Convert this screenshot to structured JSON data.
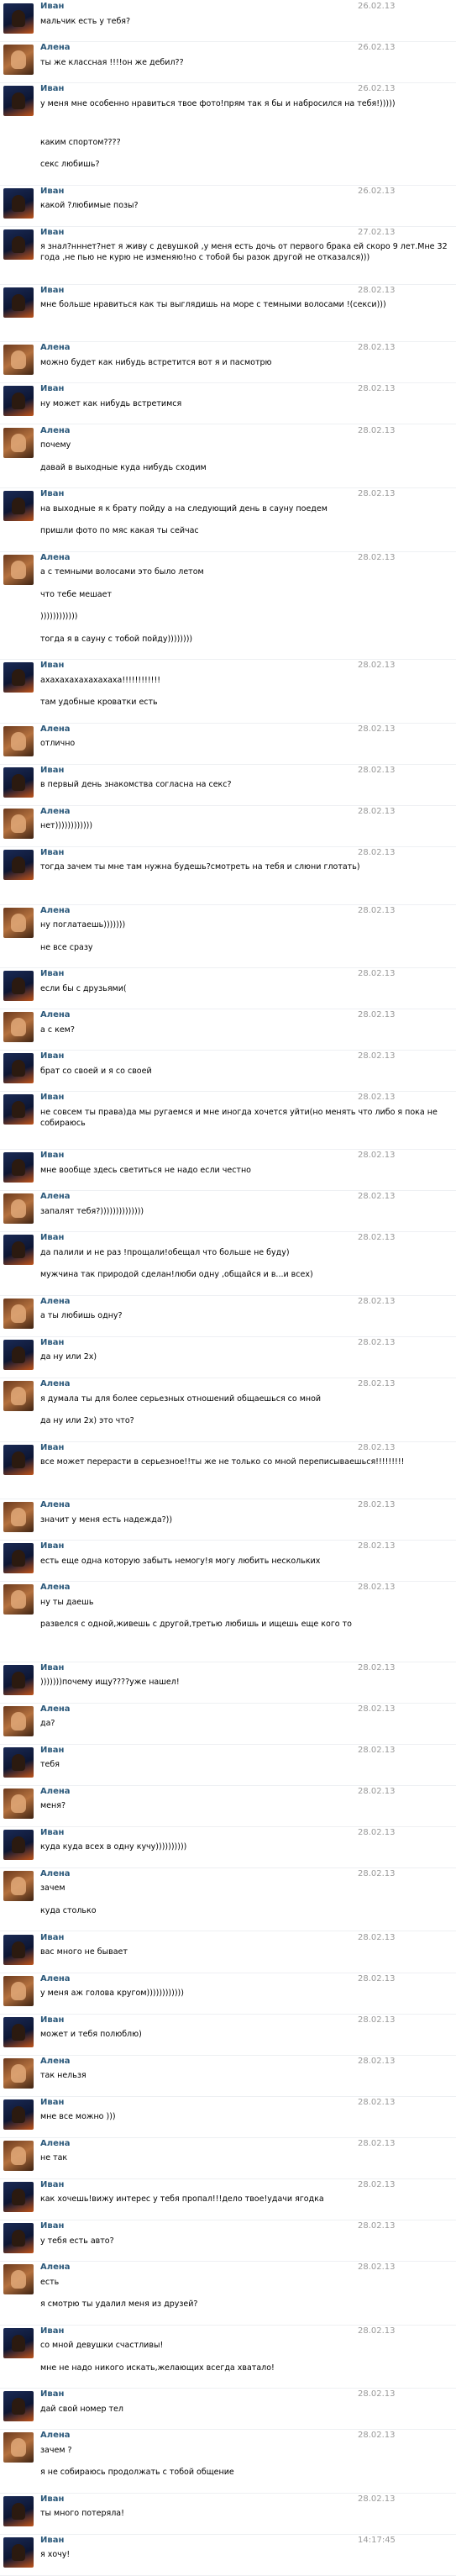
{
  "messages": [
    {
      "author": "Иван",
      "time": "26.02.13",
      "lines": [
        "мальчик есть у тебя?"
      ]
    },
    {
      "author": "Алена",
      "time": "26.02.13",
      "lines": [
        "ты же классная !!!!он же дебил??"
      ]
    },
    {
      "author": "Иван",
      "time": "26.02.13",
      "lines": [
        "у меня мне особенно нравиться твое фото!прям так я бы и набросился на тебя!)))))",
        "каким спортом????",
        "секс любишь?"
      ]
    },
    {
      "author": "Иван",
      "time": "26.02.13",
      "lines": [
        "какой ?любимые позы?"
      ]
    },
    {
      "author": "Иван",
      "time": "27.02.13",
      "lines": [
        "я знал?нннет?нет я живу с девушкой ,у меня есть дочь от первого брака ей скоро 9 лет.Мне 32 года ,не пью не курю не изменяю!но с тобой бы разок другой не отказался)))"
      ]
    },
    {
      "author": "Иван",
      "time": "28.02.13",
      "lines": [
        "мне больше нравиться как ты выглядишь на море с темными волосами !(секси)))"
      ]
    },
    {
      "author": "Алена",
      "time": "28.02.13",
      "lines": [
        "можно будет как нибудь встретится вот я и пасмотрю"
      ]
    },
    {
      "author": "Иван",
      "time": "28.02.13",
      "lines": [
        "ну может как нибудь встретимся"
      ]
    },
    {
      "author": "Алена",
      "time": "28.02.13",
      "lines": [
        "почему",
        "давай в выходные куда нибудь сходим"
      ]
    },
    {
      "author": "Иван",
      "time": "28.02.13",
      "lines": [
        "на выходные я к брату пойду а на следующий день в сауну поедем",
        "пришли фото по мяс какая ты сейчас"
      ]
    },
    {
      "author": "Алена",
      "time": "28.02.13",
      "lines": [
        "а с темными волосами это было летом",
        "что тебе мешает",
        "))))))))))))",
        "тогда я в сауну с тобой пойду))))))))"
      ]
    },
    {
      "author": "Иван",
      "time": "28.02.13",
      "lines": [
        "ахахахахахахахаха!!!!!!!!!!!!",
        "там удобные кроватки есть"
      ]
    },
    {
      "author": "Алена",
      "time": "28.02.13",
      "lines": [
        "отлично"
      ]
    },
    {
      "author": "Иван",
      "time": "28.02.13",
      "lines": [
        "в первый день знакомства согласна на секс?"
      ]
    },
    {
      "author": "Алена",
      "time": "28.02.13",
      "lines": [
        "нет))))))))))))"
      ]
    },
    {
      "author": "Иван",
      "time": "28.02.13",
      "lines": [
        "тогда зачем ты мне там нужна будешь?смотреть на тебя и слюни глотать)"
      ]
    },
    {
      "author": "Алена",
      "time": "28.02.13",
      "lines": [
        "ну поглатаешь)))))))",
        "не все сразу"
      ]
    },
    {
      "author": "Иван",
      "time": "28.02.13",
      "lines": [
        "если бы с друзьями("
      ]
    },
    {
      "author": "Алена",
      "time": "28.02.13",
      "lines": [
        "а с кем?"
      ]
    },
    {
      "author": "Иван",
      "time": "28.02.13",
      "lines": [
        "брат со своей и я со своей"
      ]
    },
    {
      "author": "Иван",
      "time": "28.02.13",
      "lines": [
        "не совсем ты права)да мы ругаемся и мне иногда хочется уйти(но менять что либо я пока не собираюсь"
      ]
    },
    {
      "author": "Иван",
      "time": "28.02.13",
      "lines": [
        "мне вообще здесь светиться не надо если честно"
      ]
    },
    {
      "author": "Алена",
      "time": "28.02.13",
      "lines": [
        "запалят тебя?))))))))))))))"
      ]
    },
    {
      "author": "Иван",
      "time": "28.02.13",
      "lines": [
        "да палили и не раз !прощали!обещал что больше не буду)",
        "мужчина так природой сделан!люби одну ,общайся и в...и всех)"
      ]
    },
    {
      "author": "Алена",
      "time": "28.02.13",
      "lines": [
        "а ты любишь одну?"
      ]
    },
    {
      "author": "Иван",
      "time": "28.02.13",
      "lines": [
        "да ну или 2х)"
      ]
    },
    {
      "author": "Алена",
      "time": "28.02.13",
      "lines": [
        "я думала ты для более серьезных отношений общаешься со мной",
        "да ну или 2х) это что?"
      ]
    },
    {
      "author": "Иван",
      "time": "28.02.13",
      "lines": [
        "все может перерасти в серьезное!!ты же не только со мной переписываешься!!!!!!!!!"
      ]
    },
    {
      "author": "Алена",
      "time": "28.02.13",
      "lines": [
        "значит у меня есть надежда?))"
      ]
    },
    {
      "author": "Иван",
      "time": "28.02.13",
      "lines": [
        "есть еще одна которую забыть немогу!я могу любить нескольких"
      ]
    },
    {
      "author": "Алена",
      "time": "28.02.13",
      "lines": [
        "ну ты даешь",
        "развелся с одной,живешь с другой,третью любишь и ищешь еще кого то"
      ]
    },
    {
      "author": "Иван",
      "time": "28.02.13",
      "lines": [
        ")))))))почему ищу????уже нашел!"
      ]
    },
    {
      "author": "Алена",
      "time": "28.02.13",
      "lines": [
        "да?"
      ]
    },
    {
      "author": "Иван",
      "time": "28.02.13",
      "lines": [
        "тебя"
      ]
    },
    {
      "author": "Алена",
      "time": "28.02.13",
      "lines": [
        "меня?"
      ]
    },
    {
      "author": "Иван",
      "time": "28.02.13",
      "lines": [
        "куда куда всех в одну кучу))))))))))"
      ]
    },
    {
      "author": "Алена",
      "time": "28.02.13",
      "lines": [
        "зачем",
        "куда столько"
      ]
    },
    {
      "author": "Иван",
      "time": "28.02.13",
      "lines": [
        "вас много не бывает"
      ]
    },
    {
      "author": "Алена",
      "time": "28.02.13",
      "lines": [
        "у меня аж голова кругом))))))))))))"
      ]
    },
    {
      "author": "Иван",
      "time": "28.02.13",
      "lines": [
        "может и тебя полюблю)"
      ]
    },
    {
      "author": "Алена",
      "time": "28.02.13",
      "lines": [
        "так нельзя"
      ]
    },
    {
      "author": "Иван",
      "time": "28.02.13",
      "lines": [
        "мне все можно )))"
      ]
    },
    {
      "author": "Алена",
      "time": "28.02.13",
      "lines": [
        "не так"
      ]
    },
    {
      "author": "Иван",
      "time": "28.02.13",
      "lines": [
        "как хочешь!вижу интерес у тебя пропал!!!дело твое!удачи ягодка"
      ]
    },
    {
      "author": "Иван",
      "time": "28.02.13",
      "lines": [
        "у тебя есть авто?"
      ]
    },
    {
      "author": "Алена",
      "time": "28.02.13",
      "lines": [
        "есть",
        "я смотрю ты удалил меня из друзей?"
      ]
    },
    {
      "author": "Иван",
      "time": "28.02.13",
      "lines": [
        "со мной девушки счастливы!",
        "мне не надо никого искать,желающих всегда хватало!"
      ]
    },
    {
      "author": "Иван",
      "time": "28.02.13",
      "lines": [
        "дай свой номер тел"
      ]
    },
    {
      "author": "Алена",
      "time": "28.02.13",
      "lines": [
        "зачем ?",
        "я не собираюсь продолжать с тобой общение"
      ]
    },
    {
      "author": "Иван",
      "time": "28.02.13",
      "lines": [
        "ты много потеряла!"
      ]
    },
    {
      "author": "Иван",
      "time": "14:17:45",
      "lines": [
        "я хочу!"
      ]
    }
  ]
}
